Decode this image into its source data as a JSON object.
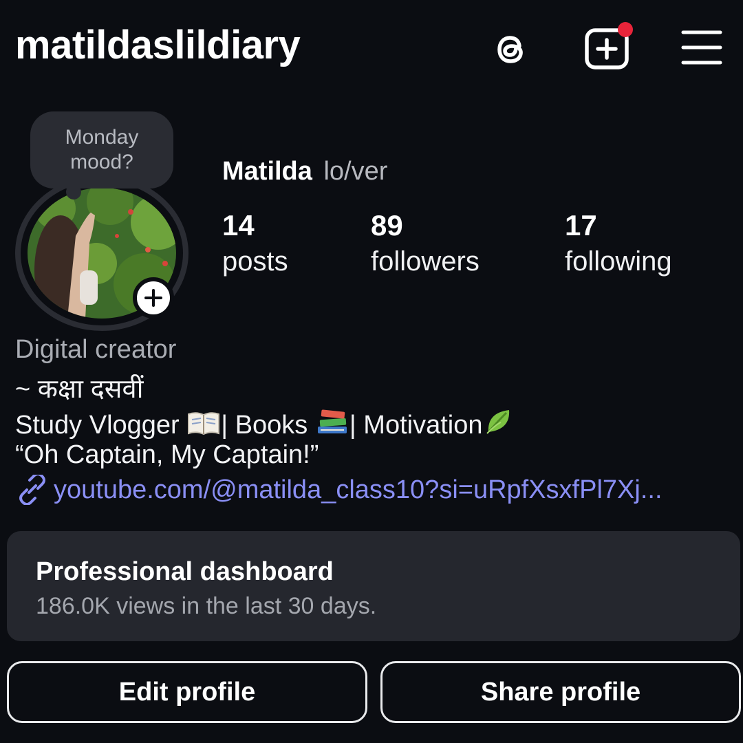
{
  "header": {
    "username": "matildaslildiary",
    "icons": [
      "threads-icon",
      "create-post-icon",
      "menu-icon"
    ],
    "notification_dot_color": "#e8243a"
  },
  "profile": {
    "note": "Monday mood?",
    "name": "Matilda",
    "pronouns": "lo/ver",
    "stats": [
      {
        "value": "14",
        "label": "posts"
      },
      {
        "value": "89",
        "label": "followers"
      },
      {
        "value": "17",
        "label": "following"
      }
    ]
  },
  "bio": {
    "category": "Digital creator",
    "line1": "~ कक्षा दसवीं",
    "line2_parts": [
      "Study Vlogger ",
      "| Books ",
      "| Motivation"
    ],
    "line2_emojis": [
      "open-book-icon",
      "books-icon",
      "leaf-icon"
    ],
    "line3": "“Oh Captain, My Captain!”",
    "link": "youtube.com/@matilda_class10?si=uRpfXsxfPl7Xj..."
  },
  "dashboard": {
    "title": "Professional dashboard",
    "subtitle": "186.0K views in the last 30 days."
  },
  "buttons": {
    "edit": "Edit profile",
    "share": "Share profile"
  },
  "colors": {
    "background": "#0b0d12",
    "card": "#25272e",
    "link": "#8a8ff5"
  }
}
